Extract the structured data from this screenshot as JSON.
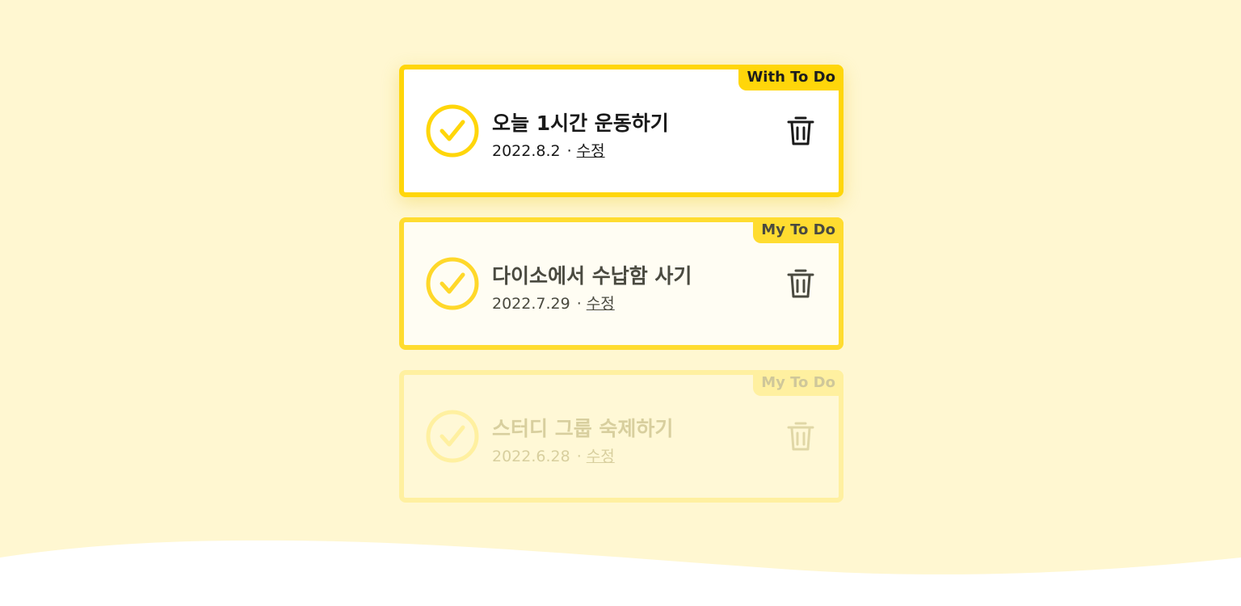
{
  "colors": {
    "background": "#fff7d1",
    "accent": "#ffd60a",
    "wave": "#ffffff"
  },
  "todos": [
    {
      "badge": "With To Do",
      "title": "오늘 1시간 운동하기",
      "date": "2022.8.2",
      "separator": "·",
      "edit_label": "수정",
      "check_icon": "check-circle-icon",
      "delete_icon": "trash-icon"
    },
    {
      "badge": "My To Do",
      "title": "다이소에서 수납함 사기",
      "date": "2022.7.29",
      "separator": "·",
      "edit_label": "수정",
      "check_icon": "check-circle-icon",
      "delete_icon": "trash-icon"
    },
    {
      "badge": "My To Do",
      "title": "스터디 그룹 숙제하기",
      "date": "2022.6.28",
      "separator": "·",
      "edit_label": "수정",
      "check_icon": "check-circle-icon",
      "delete_icon": "trash-icon"
    }
  ]
}
